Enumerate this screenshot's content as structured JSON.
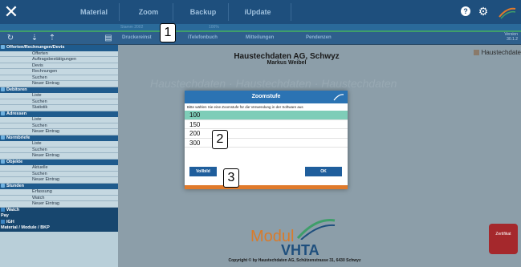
{
  "topbar": {
    "tabs": [
      "Material",
      "Zoom",
      "Backup",
      "iUpdate"
    ],
    "mandant": "Stamm 2002",
    "zoom_value": "100%"
  },
  "toolbar": {
    "items": [
      "Druckereinst",
      "iTelefonbuch",
      "Mitteilungen",
      "Pendenzen"
    ],
    "version_label": "Version",
    "version": "30.1.2"
  },
  "sidebar": [
    {
      "title": "Offerten/Rechnungen/Devis",
      "items": [
        "Offerten",
        "Auftragsbestätigungen",
        "Devis",
        "Rechnungen",
        "Suchen",
        "Neuer Eintrag"
      ]
    },
    {
      "title": "Debitoren",
      "items": [
        "Liste",
        "Suchen",
        "Statistik"
      ]
    },
    {
      "title": "Adressen",
      "items": [
        "Liste",
        "Suchen",
        "Neuer Eintrag"
      ]
    },
    {
      "title": "Normbriefe",
      "items": [
        "Liste",
        "Suchen",
        "Neuer Eintrag"
      ]
    },
    {
      "title": "Objekte",
      "items": [
        "Aktuelle",
        "Suchen",
        "Neuer Eintrag"
      ]
    },
    {
      "title": "Stunden",
      "items": [
        "Erfassung",
        "Watch",
        "Neuer Eintrag"
      ]
    }
  ],
  "sidebar_bottom": [
    "Watch",
    "Pay",
    "IGH",
    "Material / Module / BKP"
  ],
  "content": {
    "company": "Haustechdaten AG, Schwyz",
    "person": "Markus Weibel",
    "right_logo": "Haustechdate",
    "modul": "Modul",
    "vhta": "VHTA",
    "copyright": "Copyright © by Haustechdaten AG, Schützenstrasse 31, 6430 Schwyz",
    "seal": "Zertifikat"
  },
  "dialog": {
    "title": "Zoomstufe",
    "description": "Bitte wählen Sie eine Zoomstufe für die Verwendung in der Software aus",
    "options": [
      "100",
      "150",
      "200",
      "300"
    ],
    "selected": "100",
    "fullscreen_button": "Vollbild",
    "ok_button": "OK"
  },
  "markers": [
    "1",
    "2",
    "3"
  ],
  "colors": {
    "topbar": "#1e4f7d",
    "selected_option": "#7ecdb8",
    "button": "#1f5e9c",
    "accent_orange": "#e07a2b"
  }
}
